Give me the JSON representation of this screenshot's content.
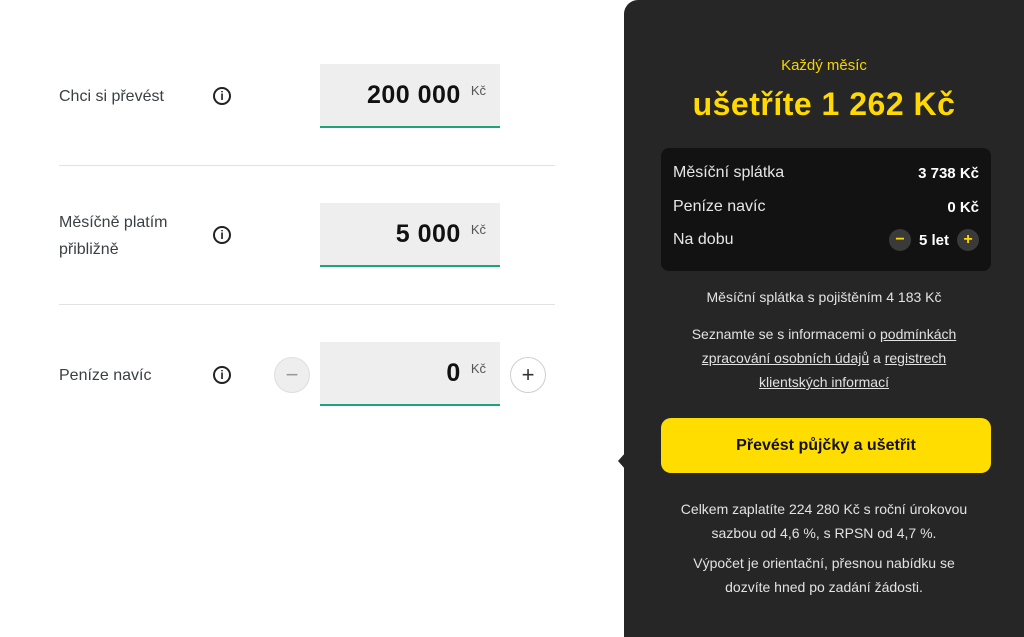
{
  "form": {
    "amount": {
      "label": "Chci si převést",
      "value": "200 000",
      "unit": "Kč"
    },
    "monthly": {
      "label_line1": "Měsíčně platím",
      "label_line2": "přibližně",
      "value": "5 000",
      "unit": "Kč"
    },
    "extra": {
      "label": "Peníze navíc",
      "value": "0",
      "unit": "Kč",
      "minus": "−",
      "plus": "+"
    },
    "info_glyph": "i"
  },
  "panel": {
    "subtitle": "Každý měsíc",
    "headline": "ušetříte 1 262 Kč",
    "summary": {
      "rows": [
        {
          "label": "Měsíční splátka",
          "value": "3 738 Kč"
        },
        {
          "label": "Peníze navíc",
          "value": "0 Kč"
        }
      ],
      "term_label": "Na dobu",
      "term_value": "5 let",
      "term_minus": "−",
      "term_plus": "+"
    },
    "insurance_note": "Měsíční splátka s pojištěním 4 183 Kč",
    "info": {
      "text1": "Seznamte se s informacemi o ",
      "link1_line1": "podmínkách",
      "link1_line2": "zpracování osobních údajů",
      "text2": " a ",
      "link2_line1": "registrech",
      "link2_line2": "klientských informací"
    },
    "cta_label": "Převést půjčky a ušetřit",
    "total_line1": "Celkem zaplatíte 224 280 Kč s roční úrokovou",
    "total_line2": "sazbou od 4,6 %, s RPSN od 4,7 %.",
    "disclaimer_line1": "Výpočet je orientační, přesnou nabídku se",
    "disclaimer_line2": "dozvíte hned po zadání žádosti."
  },
  "colors": {
    "accent_yellow": "#ffdd00",
    "field_underline": "#1aa57d",
    "panel_bg": "#262626"
  }
}
